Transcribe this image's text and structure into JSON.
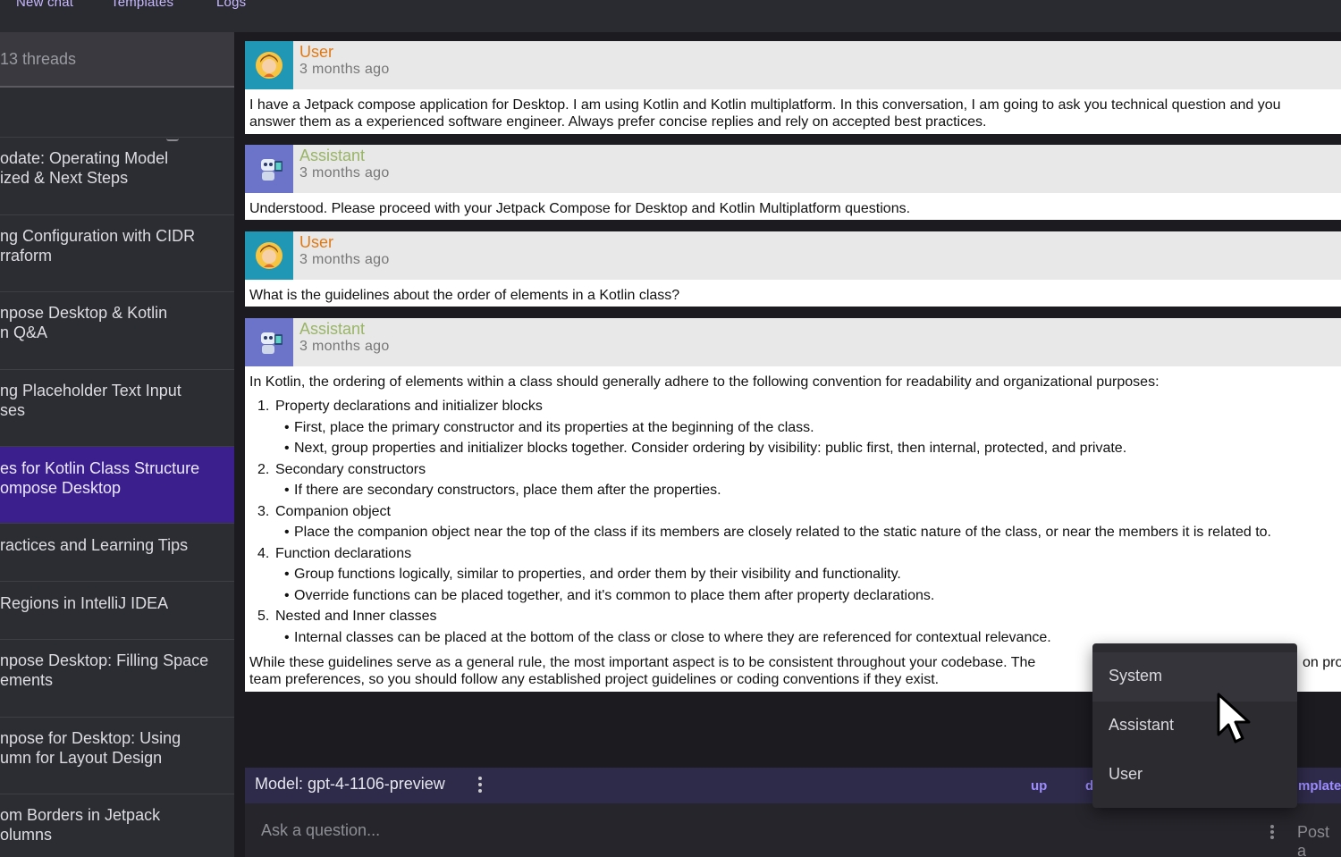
{
  "topbar": {
    "tabs": [
      "New chat",
      "Templates",
      "Logs"
    ]
  },
  "sidebar": {
    "thread_count": "13 threads",
    "threads": [
      {
        "lines": [
          "odate: Operating Model",
          "ized & Next Steps"
        ],
        "active": false
      },
      {
        "lines": [
          "ng Configuration with CIDR",
          "rraform"
        ],
        "active": false
      },
      {
        "lines": [
          "npose Desktop & Kotlin",
          "n Q&A"
        ],
        "active": false
      },
      {
        "lines": [
          "ng Placeholder Text Input",
          "ses"
        ],
        "active": false
      },
      {
        "lines": [
          "es for Kotlin Class Structure",
          "ompose Desktop"
        ],
        "active": true
      },
      {
        "lines": [
          "ractices and Learning Tips"
        ],
        "active": false
      },
      {
        "lines": [
          "Regions in IntelliJ IDEA"
        ],
        "active": false
      },
      {
        "lines": [
          "npose Desktop: Filling Space",
          "ements"
        ],
        "active": false
      },
      {
        "lines": [
          "npose for Desktop: Using",
          "umn for Layout Design"
        ],
        "active": false
      },
      {
        "lines": [
          "om Borders in Jetpack",
          "olumns"
        ],
        "active": false
      }
    ]
  },
  "messages": [
    {
      "role": "User",
      "time": "3 months ago",
      "lines": [
        "I have a Jetpack compose application for Desktop. I am using Kotlin and Kotlin multiplatform. In this conversation, I am going to ask you technical question and you",
        "answer them as a experienced software engineer. Always prefer concise replies and rely on accepted best practices."
      ]
    },
    {
      "role": "Assistant",
      "time": "3 months ago",
      "lines": [
        "Understood. Please proceed with your Jetpack Compose for Desktop and Kotlin Multiplatform questions."
      ]
    },
    {
      "role": "User",
      "time": "3 months ago",
      "lines": [
        "What is the guidelines about the order of elements in a Kotlin class?"
      ]
    },
    {
      "role": "Assistant",
      "time": "3 months ago",
      "intro": "In Kotlin, the ordering of elements within a class should generally adhere to the following convention for readability and organizational purposes:",
      "list": [
        {
          "num": "1.",
          "title": "Property declarations and initializer blocks",
          "bullets": [
            "First, place the primary constructor and its properties at the beginning of the class.",
            "Next, group properties and initializer blocks together. Consider ordering by visibility: public first, then internal, protected, and private."
          ]
        },
        {
          "num": "2.",
          "title": "Secondary constructors",
          "bullets": [
            "If there are secondary constructors, place them after the properties."
          ]
        },
        {
          "num": "3.",
          "title": "Companion object",
          "bullets": [
            "Place the companion object near the top of the class if its members are closely related to the static nature of the class, or near the members it is related to."
          ]
        },
        {
          "num": "4.",
          "title": "Function declarations",
          "bullets": [
            "Group functions logically, similar to properties, and order them by their visibility and functionality.",
            "Override functions can be placed together, and it's common to place them after property declarations."
          ]
        },
        {
          "num": "5.",
          "title": "Nested and Inner classes",
          "bullets": [
            "Internal classes can be placed at the bottom of the class or close to where they are referenced for contextual relevance."
          ]
        }
      ],
      "outro_1a": "While these guidelines serve as a general rule, the most important aspect is to be consistent throughout your codebase. The",
      "outro_1b": "on pro",
      "outro_2": "team preferences, so you should follow any established project guidelines or coding conventions if they exist."
    }
  ],
  "composer": {
    "model_label": "Model: gpt-4-1106-preview",
    "links": [
      "up",
      "d",
      "mplate"
    ],
    "placeholder": "Ask a question...",
    "post_label": "Post a"
  },
  "dropdown": {
    "items": [
      "System",
      "Assistant",
      "User"
    ],
    "hovered": "System"
  },
  "colors": {
    "accent": "#3b1f8c",
    "user_role": "#e07a16",
    "assistant_role": "#9ab568",
    "link": "#9c8cff"
  }
}
